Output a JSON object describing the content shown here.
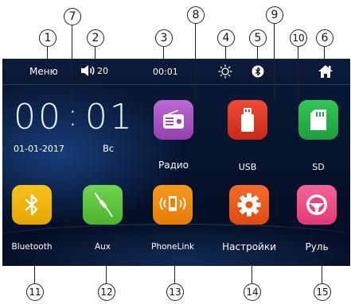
{
  "callouts": [
    "1",
    "2",
    "3",
    "4",
    "5",
    "6",
    "7",
    "8",
    "9",
    "10",
    "11",
    "12",
    "13",
    "14",
    "15"
  ],
  "topbar": {
    "menu_label": "Меню",
    "volume_value": "20",
    "clock": "00:01"
  },
  "home": {
    "big_hours": "00",
    "big_minutes": "01",
    "date": "01-01-2017",
    "weekday": "Вс"
  },
  "apps": [
    {
      "label": "Радио",
      "color": "#a84fc2",
      "icon": "radio-icon"
    },
    {
      "label": "USB",
      "color": "#e23a2a",
      "icon": "usb-drive-icon"
    },
    {
      "label": "SD",
      "color": "#26b34a",
      "icon": "sd-card-icon"
    },
    {
      "label": "Bluetooth",
      "color": "#f0b400",
      "icon": "bluetooth-icon"
    },
    {
      "label": "Aux",
      "color": "#5fc63e",
      "icon": "aux-cable-icon"
    },
    {
      "label": "PhoneLink",
      "color": "#f08a12",
      "icon": "phonelink-icon"
    },
    {
      "label": "Настройки",
      "color": "#ee5a1e",
      "icon": "gear-icon"
    },
    {
      "label": "Руль",
      "color": "#ef4f86",
      "icon": "steering-wheel-icon"
    }
  ]
}
